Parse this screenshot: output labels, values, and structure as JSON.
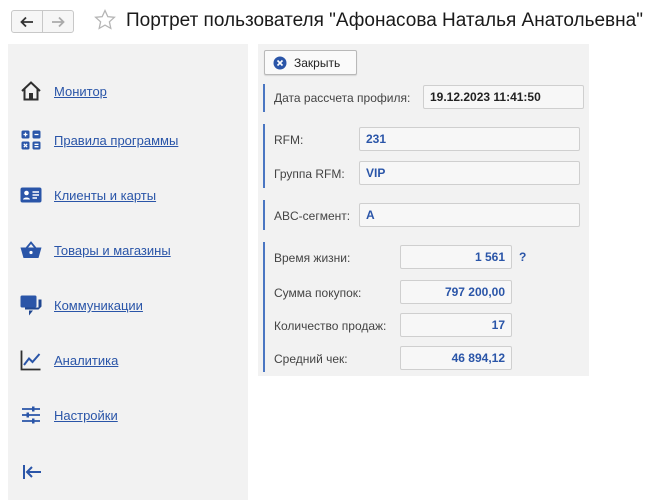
{
  "window": {
    "title": "Портрет пользователя \"Афонасова Наталья Анатольевна\""
  },
  "sidebar": {
    "items": [
      {
        "label": "Монитор",
        "icon": "home-icon"
      },
      {
        "label": "Правила программы",
        "icon": "calculator-icon"
      },
      {
        "label": "Клиенты и карты",
        "icon": "id-card-icon"
      },
      {
        "label": "Товары и магазины",
        "icon": "basket-icon"
      },
      {
        "label": "Коммуникации",
        "icon": "chat-icon"
      },
      {
        "label": "Аналитика",
        "icon": "chart-line-icon"
      },
      {
        "label": "Настройки",
        "icon": "sliders-icon"
      }
    ]
  },
  "toolbar": {
    "close_label": "Закрыть"
  },
  "profile": {
    "calc_date_label": "Дата рассчета профиля:",
    "calc_date_value": "19.12.2023 11:41:50",
    "rfm_label": "RFM:",
    "rfm_value": "231",
    "rfm_group_label": "Группа  RFM:",
    "rfm_group_value": "VIP",
    "abc_label": "ABC-сегмент:",
    "abc_value": "A",
    "lifetime_label": "Время жизни:",
    "lifetime_value": "1 561",
    "lifetime_help": "?",
    "purchase_sum_label": "Сумма покупок:",
    "purchase_sum_value": "797 200,00",
    "sales_count_label": "Количество продаж:",
    "sales_count_value": "17",
    "avg_check_label": "Средний чек:",
    "avg_check_value": "46 894,12"
  },
  "colors": {
    "accent": "#2a55a8",
    "group_bar": "#4a76c2",
    "sidebar_bg": "#f2f2f2"
  }
}
